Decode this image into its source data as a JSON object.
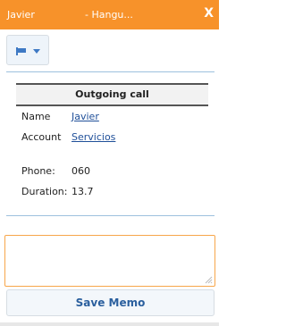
{
  "window": {
    "title_left": "Javier",
    "title_mid": "- Hangu...",
    "close_label": "X"
  },
  "toolbar": {
    "flag_icon": "flag-icon",
    "dropdown_icon": "chevron-down-icon"
  },
  "call_info": {
    "header": "Outgoing call",
    "name_label": "Name",
    "name_value": "Javier",
    "account_label": "Account",
    "account_value": "Servicios",
    "phone_label": "Phone:",
    "phone_value": "060",
    "duration_label": "Duration:",
    "duration_value": "13.7"
  },
  "memo": {
    "value": "",
    "save_label": "Save Memo"
  },
  "colors": {
    "titlebar": "#f7922a",
    "accent_blue": "#2a5f9e",
    "link": "#1f4f99"
  }
}
